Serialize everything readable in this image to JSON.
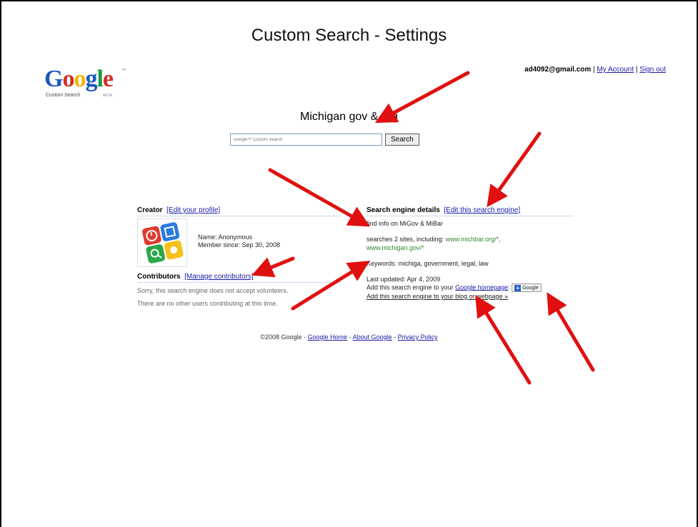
{
  "slide": {
    "title": "Custom Search - Settings"
  },
  "logo": {
    "word": [
      "G",
      "o",
      "o",
      "g",
      "l",
      "e"
    ],
    "tm": "™",
    "sub": "Custom Search",
    "beta": "BETA"
  },
  "account": {
    "email": "ad4092@gmail.com",
    "sep1": "|",
    "my_account": "My Account",
    "sep2": "|",
    "sign_out": "Sign out"
  },
  "engine": {
    "name": "Michigan gov & org"
  },
  "search": {
    "placeholder": "Google™ Custom Search",
    "button": "Search"
  },
  "creator": {
    "heading": "Creator",
    "edit_link": "[Edit your profile]",
    "name": "Name: Anonymous",
    "member_since": "Member since: Sep 30, 2008"
  },
  "contributors": {
    "heading": "Contributors",
    "manage_link": "[Manage contributors]",
    "line1": "Sorry, this search engine does not accept volunteers.",
    "line2": "There are no other users contributing at this time."
  },
  "details": {
    "heading": "Search engine details",
    "edit_link": "[Edit this search engine]",
    "description": "find info on MiGov & MiBar",
    "sites_prefix": "searches 2 sites, including:",
    "site1": "www.michbar.org/*,",
    "site2": "www.michigan.gov/*",
    "keywords": "Keywords: michiga, government, legal, law",
    "updated": "Last updated: Apr 4, 2009",
    "add_prefix": "Add this search engine to your",
    "add_homepage_link": "Google homepage",
    "add_homepage_colon": ":",
    "add_google_btn": "Google",
    "add_blog_link": "Add this search engine to your blog or webpage »"
  },
  "footer": {
    "copyright": "©2008 Google -",
    "home": "Google Home",
    "sep1": "-",
    "about": "About Google",
    "sep2": "-",
    "privacy": "Privacy Policy"
  },
  "colors": {
    "link": "#1a1aa6",
    "arrow": "#e01010",
    "site_url": "#2d8a2d"
  }
}
